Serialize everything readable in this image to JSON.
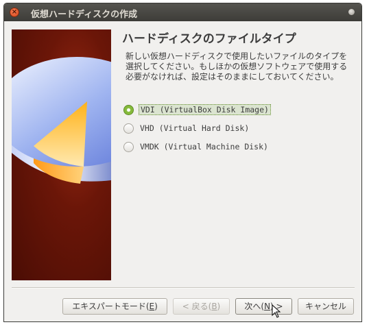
{
  "window": {
    "title": "仮想ハードディスクの作成"
  },
  "page": {
    "heading": "ハードディスクのファイルタイプ",
    "description": "新しい仮想ハードディスクで使用したいファイルのタイプを選択してください。もしほかの仮想ソフトウェアで使用する必要がなければ、設定はそのままにしておいてください。"
  },
  "options": [
    {
      "label": "VDI (VirtualBox Disk Image)",
      "checked": true
    },
    {
      "label": "VHD (Virtual Hard Disk)",
      "checked": false
    },
    {
      "label": "VMDK (Virtual Machine Disk)",
      "checked": false
    }
  ],
  "buttons": {
    "expert": {
      "text": "エキスパートモード(",
      "mnemonic": "E",
      "suffix": ")"
    },
    "back": {
      "text": "< 戻る(",
      "mnemonic": "B",
      "suffix": ")"
    },
    "next": {
      "text": "次へ(",
      "mnemonic": "N",
      "suffix": ") >"
    },
    "cancel": {
      "text": "キャンセル"
    }
  },
  "colors": {
    "titlebar": "#3d3c38",
    "accent_radio": "#85ba3b",
    "close_button": "#e05a2b"
  },
  "icons": {
    "close": "close-icon",
    "window_menu": "window-menu-icon",
    "side_art": "hard-disk-pie-illustration",
    "cursor": "mouse-pointer"
  }
}
